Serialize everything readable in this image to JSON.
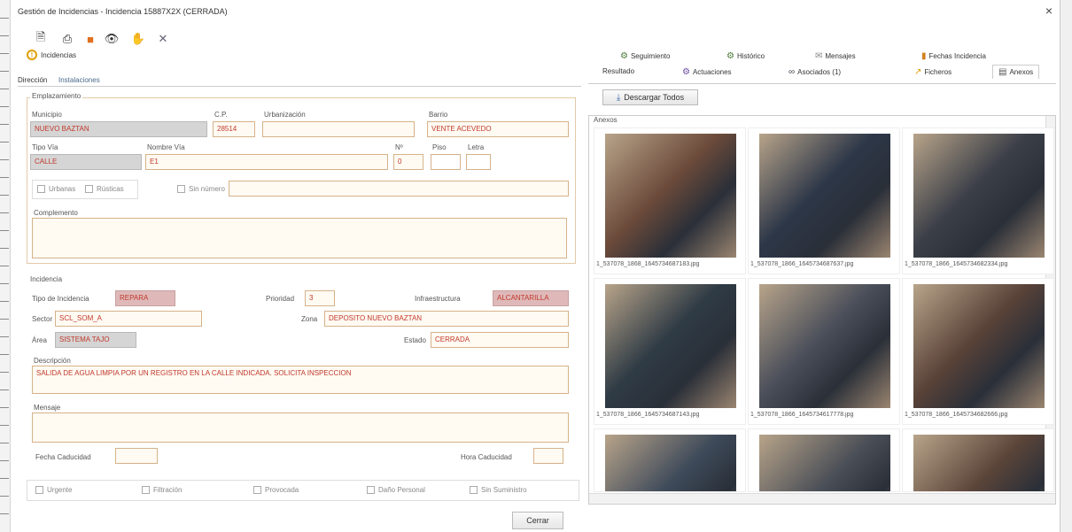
{
  "window": {
    "title": "Gestión de Incidencias - Incidencia 15887X2X (CERRADA)",
    "close_glyph": "×"
  },
  "toolbar": {
    "icons": [
      {
        "name": "document-icon",
        "glyph": "🗎",
        "color": "#333"
      },
      {
        "name": "print-icon",
        "glyph": "⎙",
        "color": "#222"
      },
      {
        "name": "save-icon",
        "glyph": "■",
        "color": "#e07020"
      },
      {
        "name": "eye-icon",
        "glyph": "👁",
        "color": "#333"
      },
      {
        "name": "hand-icon",
        "glyph": "✋",
        "color": "#d02020"
      },
      {
        "name": "tools-icon",
        "glyph": "✕",
        "color": "#667"
      }
    ]
  },
  "section_tab": {
    "label": "Incidencias",
    "icon": "warning-icon"
  },
  "subtabs": [
    "Dirección",
    "Instalaciones"
  ],
  "emplazamiento": {
    "label": "Emplazamiento",
    "municipio": {
      "label": "Municipio",
      "value": "NUEVO BAZTAN"
    },
    "cp": {
      "label": "C.P.",
      "value": "28514"
    },
    "urbanizacion": {
      "label": "Urbanización",
      "value": ""
    },
    "barrio": {
      "label": "Barrio",
      "value": "VENTE ACEVEDO"
    },
    "tipo_via": {
      "label": "Tipo Vía",
      "value": "CALLE"
    },
    "nombre_via": {
      "label": "Nombre Vía",
      "value": "E1"
    },
    "numero": {
      "label": "Nº",
      "value": "0"
    },
    "piso": {
      "label": "Piso",
      "value": ""
    },
    "letra": {
      "label": "Letra",
      "value": ""
    },
    "check_urbanas": "Urbanas",
    "check_rusticas": "Rústicas",
    "check_sin_numero": "Sin número",
    "sin_numero_value": ""
  },
  "complemento": {
    "label": "Complemento",
    "value": ""
  },
  "incidencia": {
    "label": "Incidencia",
    "tipo": {
      "label": "Tipo de Incidencia",
      "value": "REPARA"
    },
    "prioridad": {
      "label": "Prioridad",
      "value": "3"
    },
    "infraestructura": {
      "label": "Infraestructura",
      "value": "ALCANTARILLA"
    },
    "sector": {
      "label": "Sector",
      "value": "SCL_SOM_A"
    },
    "zona": {
      "label": "Zona",
      "value": "DEPOSITO NUEVO BAZTAN"
    },
    "area": {
      "label": "Área",
      "value": "SISTEMA TAJO"
    },
    "estado": {
      "label": "Estado",
      "value": "CERRADA"
    },
    "descripcion": {
      "label": "Descripción",
      "value": "SALIDA DE AGUA LIMPIA POR UN REGISTRO EN LA CALLE INDICADA. SOLICITA INSPECCION"
    },
    "mensaje": {
      "label": "Mensaje",
      "value": ""
    },
    "fecha_caducidad": {
      "label": "Fecha Caducidad",
      "value": ""
    },
    "hora_caducidad": {
      "label": "Hora Caducidad",
      "value": ""
    }
  },
  "bottom_checks": [
    "Urgente",
    "Filtración",
    "Provocada",
    "Daño Personal",
    "Sin Suministro"
  ],
  "cerrar_button": "Cerrar",
  "right_tabs_row1": [
    {
      "label": "Seguimiento",
      "icon": "tracking-icon"
    },
    {
      "label": "Histórico",
      "icon": "history-icon"
    },
    {
      "label": "Mensajes",
      "icon": "message-icon"
    },
    {
      "label": "Fechas Incidencia",
      "icon": "chart-icon"
    }
  ],
  "right_tabs_row2": [
    {
      "label": "Resultado",
      "icon": ""
    },
    {
      "label": "Actuaciones",
      "icon": "actions-icon"
    },
    {
      "label": "Asociados (1)",
      "icon": "link-icon"
    },
    {
      "label": "Ficheros",
      "icon": "files-icon"
    },
    {
      "label": "Anexos",
      "icon": "attachment-icon"
    }
  ],
  "download_button": "Descargar Todos",
  "anexos_label": "Anexos",
  "thumbnails": [
    {
      "caption": "1_537078_1868_1645734687183.jpg",
      "tone": "#6b4a3a"
    },
    {
      "caption": "1_537078_1866_1645734687637.jpg",
      "tone": "#2d3748"
    },
    {
      "caption": "1_537078_1866_1645734682334.jpg",
      "tone": "#3b3f48"
    },
    {
      "caption": "1_537078_1866_1645734687143.jpg",
      "tone": "#2f3b45"
    },
    {
      "caption": "1_537078_1866_1645734617778.jpg",
      "tone": "#4a4f5a"
    },
    {
      "caption": "1_537078_1866_1645734682666.jpg",
      "tone": "#594238"
    },
    {
      "caption": "",
      "tone": "#3e4a5a"
    },
    {
      "caption": "",
      "tone": "#4b4f57"
    },
    {
      "caption": "",
      "tone": "#5a4439"
    }
  ]
}
